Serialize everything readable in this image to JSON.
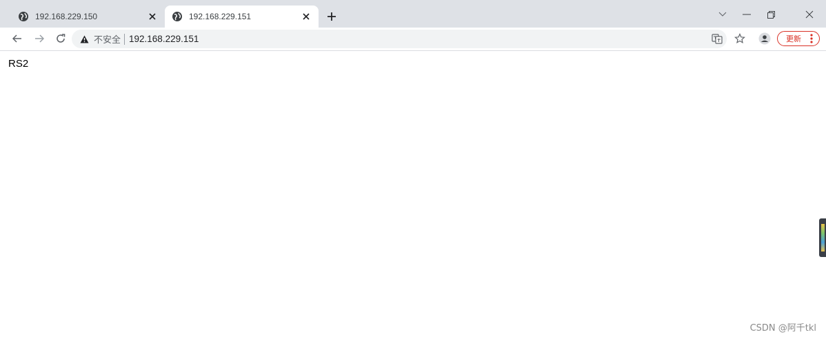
{
  "tabs": [
    {
      "title": "192.168.229.150",
      "icon": "globe-icon",
      "active": false
    },
    {
      "title": "192.168.229.151",
      "icon": "globe-icon",
      "active": true
    }
  ],
  "toolbar": {
    "security_label": "不安全",
    "url": "192.168.229.151",
    "update_label": "更新"
  },
  "page": {
    "text": "RS2"
  },
  "watermark": "CSDN @阿千tkl",
  "colors": {
    "tabstrip_bg": "#dee1e6",
    "omnibox_bg": "#f1f3f4",
    "update_accent": "#d93025"
  }
}
